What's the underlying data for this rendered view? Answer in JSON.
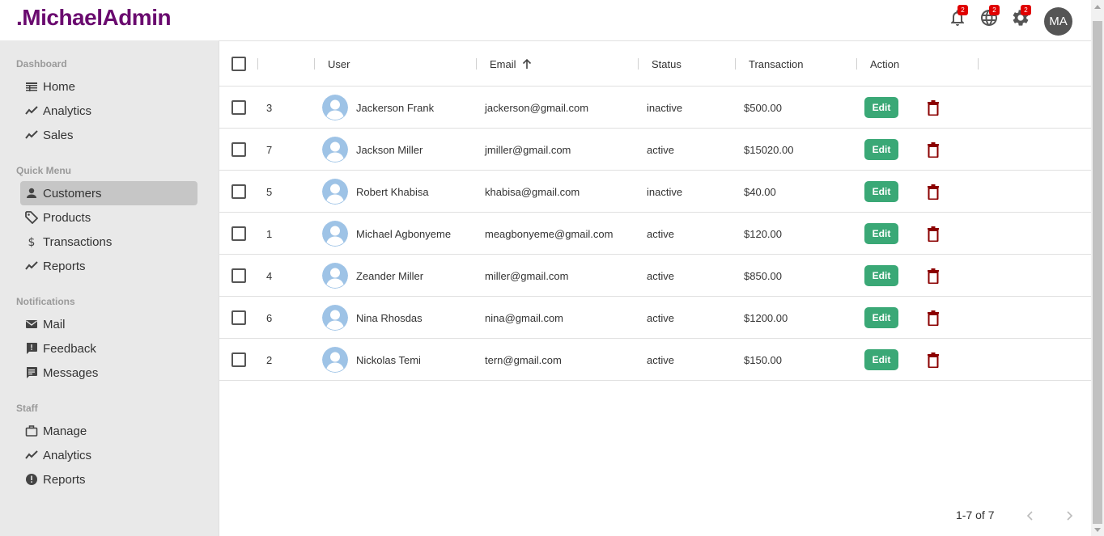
{
  "app": {
    "logo": ".MichaelAdmin",
    "avatar_initials": "MA",
    "notifications": [
      {
        "icon": "bell-icon",
        "badge": "2"
      },
      {
        "icon": "globe-icon",
        "badge": "2"
      },
      {
        "icon": "gear-icon",
        "badge": "2"
      }
    ]
  },
  "sidebar": {
    "sections": [
      {
        "title": "Dashboard",
        "items": [
          {
            "label": "Home",
            "icon": "home-table-icon"
          },
          {
            "label": "Analytics",
            "icon": "trending-up-icon"
          },
          {
            "label": "Sales",
            "icon": "trending-up-icon"
          }
        ]
      },
      {
        "title": "Quick Menu",
        "items": [
          {
            "label": "Customers",
            "icon": "person-icon",
            "active": true
          },
          {
            "label": "Products",
            "icon": "tag-icon"
          },
          {
            "label": "Transactions",
            "icon": "dollar-icon"
          },
          {
            "label": "Reports",
            "icon": "trending-up-icon"
          }
        ]
      },
      {
        "title": "Notifications",
        "items": [
          {
            "label": "Mail",
            "icon": "mail-icon"
          },
          {
            "label": "Feedback",
            "icon": "feedback-icon"
          },
          {
            "label": "Messages",
            "icon": "message-icon"
          }
        ]
      },
      {
        "title": "Staff",
        "items": [
          {
            "label": "Manage",
            "icon": "briefcase-icon"
          },
          {
            "label": "Analytics",
            "icon": "trending-up-icon"
          },
          {
            "label": "Reports",
            "icon": "error-icon"
          }
        ]
      }
    ]
  },
  "table": {
    "columns": [
      "",
      "User",
      "Email",
      "Status",
      "Transaction",
      "Action"
    ],
    "sort": {
      "column": "Email",
      "direction": "ascending"
    },
    "edit_label": "Edit",
    "rows": [
      {
        "id": "3",
        "user": "Jackerson Frank",
        "email": "jackerson@gmail.com",
        "status": "inactive",
        "transaction": "$500.00"
      },
      {
        "id": "7",
        "user": "Jackson Miller",
        "email": "jmiller@gmail.com",
        "status": "active",
        "transaction": "$15020.00"
      },
      {
        "id": "5",
        "user": "Robert Khabisa",
        "email": "khabisa@gmail.com",
        "status": "inactive",
        "transaction": "$40.00"
      },
      {
        "id": "1",
        "user": "Michael Agbonyeme",
        "email": "meagbonyeme@gmail.com",
        "status": "active",
        "transaction": "$120.00"
      },
      {
        "id": "4",
        "user": "Zeander Miller",
        "email": "miller@gmail.com",
        "status": "active",
        "transaction": "$850.00"
      },
      {
        "id": "6",
        "user": "Nina Rhosdas",
        "email": "nina@gmail.com",
        "status": "active",
        "transaction": "$1200.00"
      },
      {
        "id": "2",
        "user": "Nickolas Temi",
        "email": "tern@gmail.com",
        "status": "active",
        "transaction": "$150.00"
      }
    ],
    "pagination": "1-7 of 7"
  },
  "colors": {
    "brand": "#6a0a6f",
    "edit_button": "#3aa876",
    "delete_icon": "#8b0000",
    "badge": "#e00000",
    "active_nav": "#c6c6c6"
  }
}
